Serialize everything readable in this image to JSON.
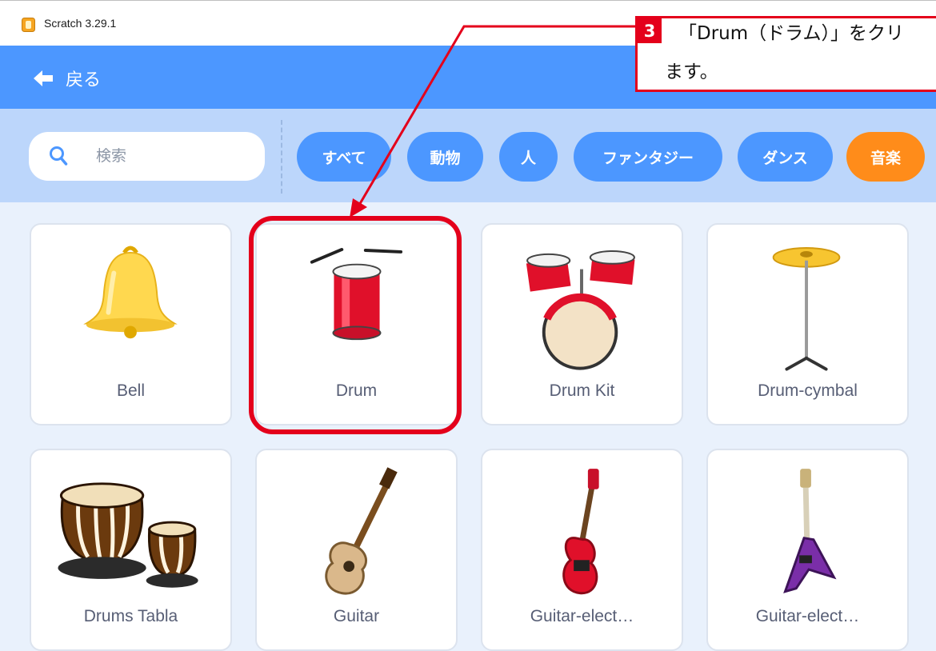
{
  "window": {
    "title": "Scratch 3.29.1",
    "icon": "scratch-icon"
  },
  "header": {
    "back_label": "戻る",
    "back_icon": "arrow-left-icon"
  },
  "search": {
    "placeholder": "検索",
    "icon": "search-icon"
  },
  "tags": [
    {
      "label": "すべて",
      "active": false
    },
    {
      "label": "動物",
      "active": false
    },
    {
      "label": "人",
      "active": false
    },
    {
      "label": "ファンタジー",
      "active": false
    },
    {
      "label": "ダンス",
      "active": false
    },
    {
      "label": "音楽",
      "active": true
    }
  ],
  "sprites": [
    {
      "name": "Bell",
      "icon": "bell"
    },
    {
      "name": "Drum",
      "icon": "drum"
    },
    {
      "name": "Drum Kit",
      "icon": "drum-kit"
    },
    {
      "name": "Drum-cymbal",
      "icon": "cymbal"
    },
    {
      "name": "Drums Tabla",
      "icon": "tabla"
    },
    {
      "name": "Guitar",
      "icon": "guitar"
    },
    {
      "name": "Guitar-elect…",
      "icon": "electric-guitar"
    },
    {
      "name": "Guitar-elect…",
      "icon": "electric-guitar-purple"
    }
  ],
  "annotation": {
    "step": "3",
    "line1": "「Drum（ドラム）」をクリ",
    "line2": "ます。",
    "color": "#e4001b"
  },
  "colors": {
    "header": "#4c97ff",
    "active_tag": "#ff8c1a",
    "filter_bar": "#bcd6fb"
  }
}
